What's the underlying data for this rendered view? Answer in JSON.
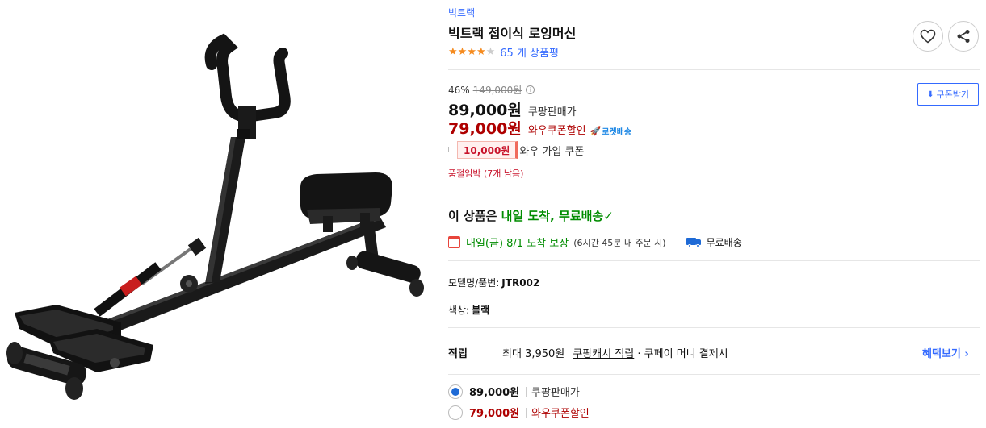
{
  "brand": "빅트랙",
  "product_title": "빅트랙 접이식 로잉머신",
  "rating": {
    "stars": 4,
    "max": 5,
    "review_count_label": "65 개 상품평"
  },
  "price": {
    "discount_rate": "46%",
    "original_price": "149,000원",
    "info_icon": "ⓘ",
    "sale_price": "89,000원",
    "sale_label": "쿠팡판매가",
    "wow_price": "79,000원",
    "wow_label": "와우쿠폰할인",
    "rocket_badge": "로켓배송"
  },
  "coupon_button_label": "쿠폰받기",
  "wow_coupon": {
    "amount": "10,000원",
    "label": "와우 가입 쿠폰"
  },
  "stock_note": "품절임박 (7개 남음)",
  "delivery": {
    "headline_prefix": "이 상품은",
    "headline_highlight": "내일 도착, 무료배송",
    "check": "✓",
    "arrival": "내일(금) 8/1 도착 보장",
    "arrival_note": "(6시간 45분 내 주문 시)",
    "free_shipping": "무료배송"
  },
  "specs": {
    "model_label": "모델명/품번:",
    "model_value": "JTR002",
    "color_label": "색상:",
    "color_value": "블랙"
  },
  "points": {
    "label": "적립",
    "text": "최대 3,950원",
    "link": "쿠팡캐시 적립",
    "suffix": "· 쿠페이 머니 결제시",
    "benefit_link": "혜택보기 ›"
  },
  "options": [
    {
      "price": "89,000원",
      "label": "쿠팡판매가",
      "selected": true
    },
    {
      "price": "79,000원",
      "label": "와우쿠폰할인",
      "selected": false
    }
  ],
  "colors": {
    "accent_blue": "#346aff",
    "price_red": "#ae0000",
    "delivery_green": "#008c00",
    "star_orange": "#f58b1f"
  },
  "icons": {
    "wish": "heart-icon",
    "share": "share-icon",
    "download": "download-icon",
    "calendar": "calendar-icon",
    "truck": "truck-icon",
    "rocket": "rocket-icon"
  }
}
